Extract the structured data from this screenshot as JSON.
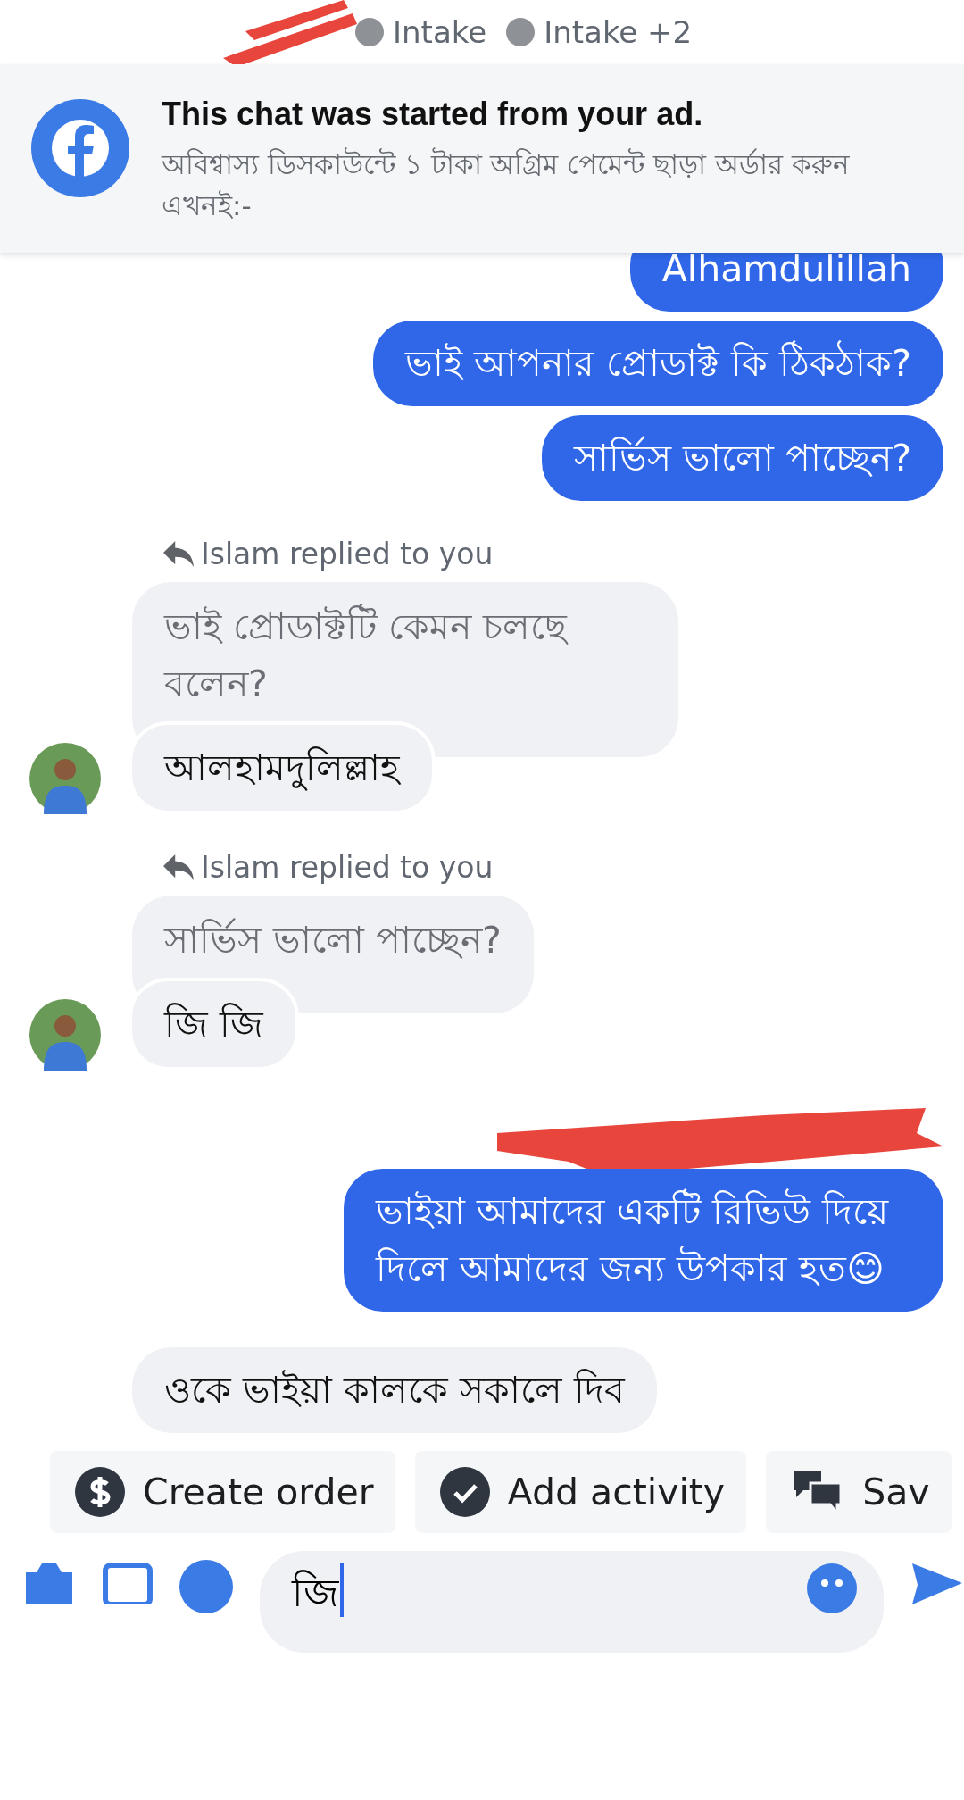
{
  "header": {
    "labels": [
      "Intake",
      "Intake +2"
    ]
  },
  "ad_banner": {
    "title": "This chat was started from your ad.",
    "text": "অবিশ্বাস্য ডিসকাউন্টে ১ টাকা অগ্রিম পেমেন্ট ছাড়া অর্ডার করুন এখনই:-"
  },
  "messages": [
    {
      "kind": "outgoing",
      "text": "Alhamdulillah"
    },
    {
      "kind": "outgoing",
      "text": "ভাই আপনার প্রোডাক্ট কি ঠিকঠাক?"
    },
    {
      "kind": "outgoing",
      "text": "সার্ভিস ভালো পাচ্ছেন?"
    },
    {
      "kind": "reply",
      "label": "Islam replied to you",
      "quoted": "ভাই প্রোডাক্টটি কেমন চলছে বলেন?",
      "text": "আলহামদুলিল্লাহ"
    },
    {
      "kind": "reply",
      "label": "Islam replied to you",
      "quoted": "সার্ভিস ভালো পাচ্ছেন?",
      "text": "জি জি"
    },
    {
      "kind": "redacted"
    },
    {
      "kind": "outgoing",
      "text": "ভাইয়া আমাদের একটি রিভিউ দিয়ে দিলে আমাদের জন্য উপকার হত😊"
    },
    {
      "kind": "incoming",
      "text": "ওকে ভাইয়া কালকে সকালে দিব"
    }
  ],
  "actions": [
    {
      "kind": "dollar",
      "label": "Create order"
    },
    {
      "kind": "check",
      "label": "Add activity"
    },
    {
      "kind": "chat",
      "label": "Sav"
    }
  ],
  "composer": {
    "value": "জি"
  }
}
